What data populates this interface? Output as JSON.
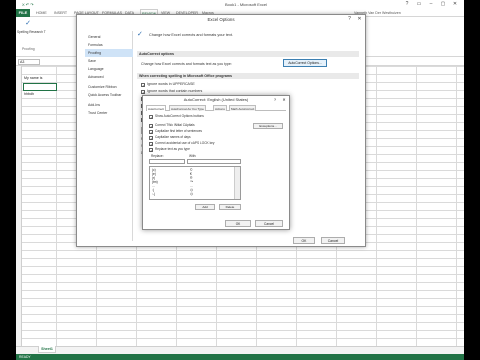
{
  "window": {
    "title": "Book1 - Microsoft Excel",
    "qat": "X ↶ ↷",
    "controls": [
      "?",
      "▭",
      "–",
      "▢",
      "✕"
    ]
  },
  "ribbon": {
    "file_tab": "FILE",
    "tabs": [
      "HOME",
      "INSERT",
      "PAGE LAYOUT",
      "FORMULAS",
      "DATA",
      "REVIEW",
      "VIEW",
      "DEVELOPER",
      "Macros"
    ],
    "active_tab": "REVIEW",
    "user": "Vanneth Van Der Westhuizen",
    "spelling_button": "Spelling",
    "research_button": "Research T",
    "group_label": "Proofing"
  },
  "formula_bar": {
    "name_box": "A3"
  },
  "sheet": {
    "cells": [
      "My name is",
      "hhbdh"
    ],
    "tab": "Sheet1",
    "status": "READY"
  },
  "options_dialog": {
    "title": "Excel Options",
    "nav": [
      "General",
      "Formulas",
      "Proofing",
      "Save",
      "Language",
      "Advanced",
      "Customize Ribbon",
      "Quick Access Toolbar",
      "Add-Ins",
      "Trust Center"
    ],
    "active_nav": "Proofing",
    "heading": "Change how Excel corrects and formats your text.",
    "section1": "AutoCorrect options",
    "autocorrect_text": "Change how Excel corrects and formats text as you type:",
    "autocorrect_button": "AutoCorrect Options...",
    "section2": "When correcting spelling in Microsoft Office programs",
    "check1": "Ignore words in UPPERCASE",
    "check2": "Ignore words that contain numbers",
    "check3": "Ignore Internet and file addresses",
    "check4": "Flag repeated words",
    "check5": "Enforce accented uppercase in French",
    "check6": "Suggest from main dictionary only",
    "custom_dict_button": "Custom Dictionaries...",
    "french_label": "French modes:",
    "spanish_label": "Spanish modes:",
    "dictionary_label": "Dictionary language:",
    "ok_label": "OK",
    "cancel_label": "Cancel"
  },
  "autocorrect_dialog": {
    "title": "AutoCorrect: English (United States)",
    "tabs": [
      "AutoCorrect",
      "AutoFormat As You Type",
      "Actions",
      "Math AutoCorrect"
    ],
    "active_tab": "AutoCorrect",
    "show_buttons": "Show AutoCorrect Options buttons",
    "exceptions_button": "Exceptions...",
    "opt1": "Correct TWo INitial CApitals",
    "opt2": "Capitalize first letter of sentences",
    "opt3": "Capitalize names of days",
    "opt4": "Correct accidental use of cAPS LOCK key",
    "opt5": "Replace text as you type",
    "replace_label": "Replace:",
    "with_label": "With:",
    "rows": [
      {
        "replace": "(c)",
        "with": "©"
      },
      {
        "replace": "(e)",
        "with": "€"
      },
      {
        "replace": "(r)",
        "with": "®"
      },
      {
        "replace": "(tm)",
        "with": "™"
      },
      {
        "replace": "...",
        "with": "…"
      },
      {
        "replace": ":(",
        "with": "☹"
      },
      {
        "replace": ":-(",
        "with": "☹"
      }
    ],
    "add_label": "Add",
    "delete_label": "Delete",
    "ok_label": "OK",
    "cancel_label": "Cancel",
    "close_icon": "✕",
    "help_icon": "?"
  }
}
